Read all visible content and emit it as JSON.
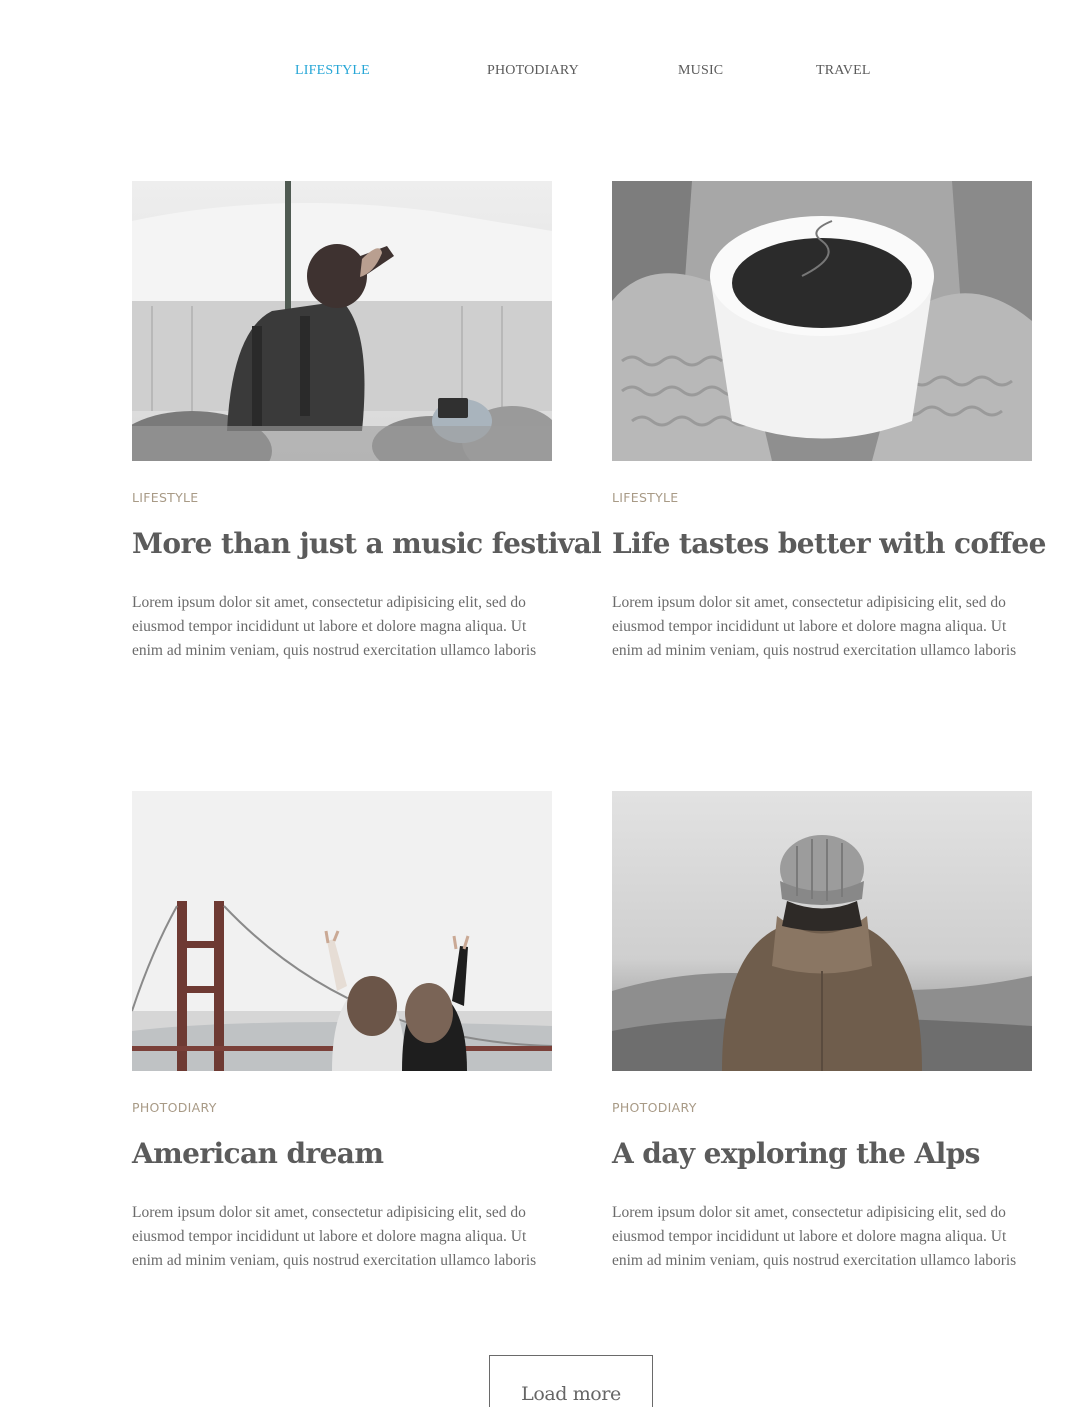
{
  "nav": {
    "items": [
      {
        "label": "LIFESTYLE",
        "active": true
      },
      {
        "label": "PHOTODIARY",
        "active": false
      },
      {
        "label": "MUSIC",
        "active": false
      },
      {
        "label": "TRAVEL",
        "active": false
      }
    ],
    "active_color": "#26a6d6"
  },
  "posts": [
    {
      "category": "LIFESTYLE",
      "title": "More than just a music festival",
      "excerpt": "Lorem ipsum dolor sit amet, consectetur adipisicing elit, sed do eiusmod tempor incididunt ut labore et dolore magna aliqua. Ut enim ad minim veniam, quis nostrud exercitation ullamco laboris",
      "image": "concert-crowd-photo"
    },
    {
      "category": "LIFESTYLE",
      "title": "Life tastes better with coffee",
      "excerpt": "Lorem ipsum dolor sit amet, consectetur adipisicing elit, sed do eiusmod tempor incididunt ut labore et dolore magna aliqua. Ut enim ad minim veniam, quis nostrud exercitation ullamco laboris",
      "image": "coffee-cup-mittens-photo"
    },
    {
      "category": "PHOTODIARY",
      "title": "American dream",
      "excerpt": "Lorem ipsum dolor sit amet, consectetur adipisicing elit, sed do eiusmod tempor incididunt ut labore et dolore magna aliqua. Ut enim ad minim veniam, quis nostrud exercitation ullamco laboris",
      "image": "golden-gate-friends-photo"
    },
    {
      "category": "PHOTODIARY",
      "title": "A day exploring the Alps",
      "excerpt": "Lorem ipsum dolor sit amet, consectetur adipisicing elit, sed do eiusmod tempor incididunt ut labore et dolore magna aliqua. Ut enim ad minim veniam, quis nostrud exercitation ullamco laboris",
      "image": "hiker-in-fog-photo"
    }
  ],
  "load_more_label": "Load more",
  "colors": {
    "category": "#a89a86",
    "text": "#5a5a5a"
  }
}
